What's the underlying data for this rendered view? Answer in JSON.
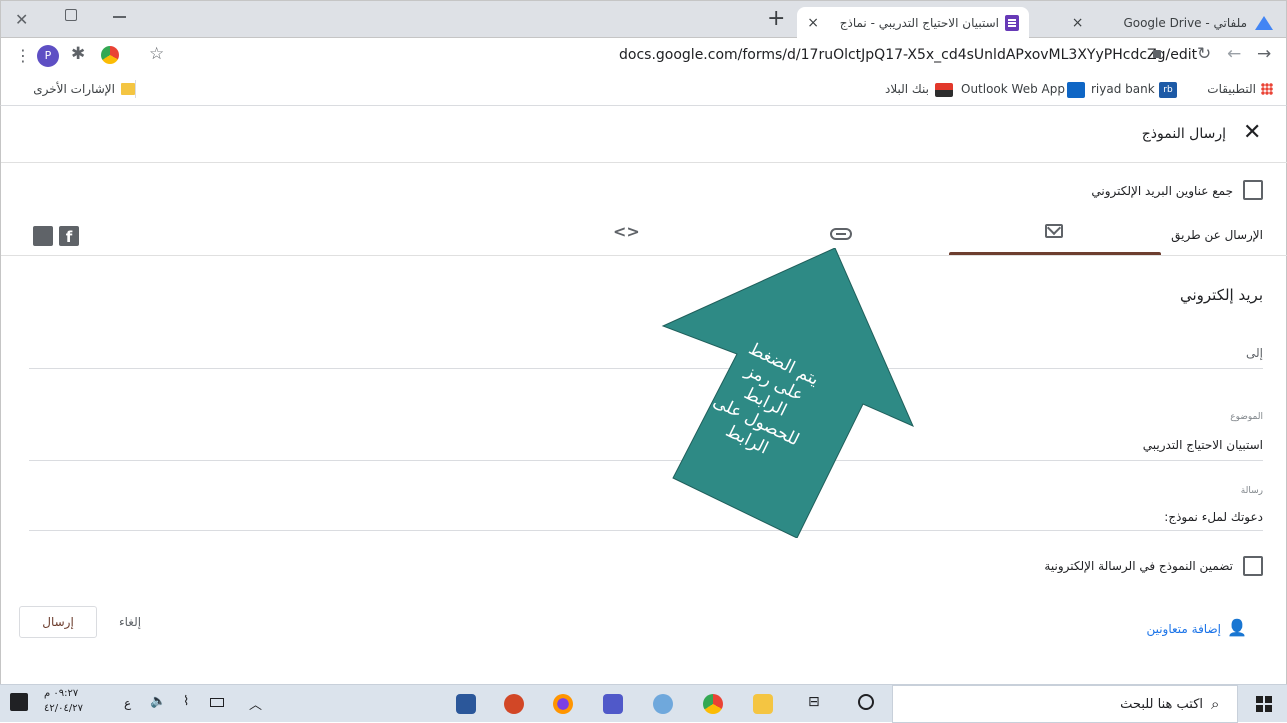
{
  "browser": {
    "tabs": [
      {
        "title": "ملفاتي - Google Drive",
        "close": "×"
      },
      {
        "title": "استبيان الاحتياج التدريبي - نماذج",
        "close": "×"
      }
    ],
    "new_tab": "+",
    "url": "docs.google.com/forms/d/17ruOlctJpQ17-X5x_cd4sUnldAPxovML3XYyPHcdcZg/edit",
    "profile_initial": "P",
    "bookmarks": [
      {
        "label": "التطبيقات"
      },
      {
        "label": "riyad bank"
      },
      {
        "label": "Outlook Web App"
      },
      {
        "label": "بنك البلاد"
      }
    ],
    "other_bookmarks": "الإشارات الأخرى"
  },
  "dialog": {
    "title": "إرسال النموذج",
    "collect_emails": "جمع عناوين البريد الإلكتروني",
    "send_via": "الإرسال عن طريق",
    "section_title": "بريد إلكتروني",
    "to_label": "إلى",
    "subject_label": "الموضوع",
    "subject_value": "استبيان الاحتياج التدريبي",
    "message_label": "رسالة",
    "message_value": "دعوتك لملء نموذج:",
    "include_form": "تضمين النموذج في الرسالة الإلكترونية",
    "add_collaborators": "إضافة متعاونين",
    "cancel": "إلغاء",
    "send": "إرسال",
    "accent_color": "#6d3e2f"
  },
  "annotation": {
    "text_lines": [
      "يتم الضغط",
      "على رمز",
      "الرابط",
      "للحصول على",
      "الرابط"
    ],
    "fill_color": "#2e8a85"
  },
  "taskbar": {
    "search_placeholder": "اكتب هنا للبحث",
    "time": "٠٩:٢٧ م",
    "date": "٤٢/٠٤/٢٧",
    "lang": "ع"
  }
}
